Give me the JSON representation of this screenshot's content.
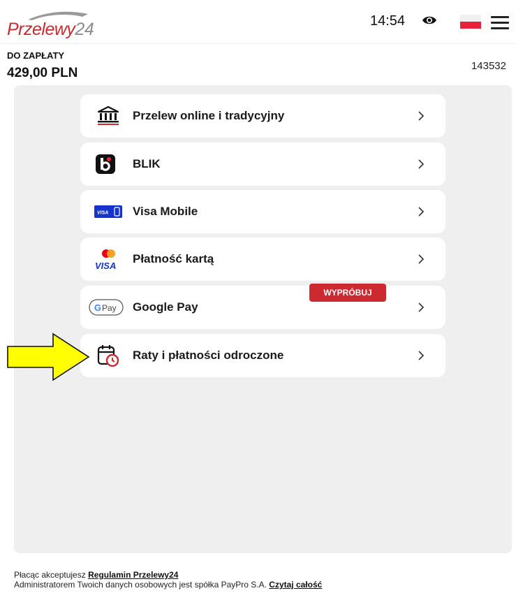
{
  "header": {
    "logo_red": "Przelewy",
    "logo_gray": "24",
    "time": "14:54"
  },
  "payment": {
    "amount_label": "DO ZAPŁATY",
    "amount": "429,00 PLN",
    "order_id": "143532"
  },
  "methods": [
    {
      "label": "Przelew online i tradycyjny",
      "icon": "bank-icon"
    },
    {
      "label": "BLIK",
      "icon": "blik-icon"
    },
    {
      "label": "Visa Mobile",
      "icon": "visa-mobile-icon"
    },
    {
      "label": "Płatność kartą",
      "icon": "card-icon"
    },
    {
      "label": "Google Pay",
      "icon": "google-pay-icon",
      "badge": "WYPRÓBUJ"
    },
    {
      "label": "Raty i płatności odroczone",
      "icon": "calendar-clock-icon"
    }
  ],
  "icon_text": {
    "visa_mobile": "VISA",
    "card_visa": "VISA",
    "gpay": "Pay"
  },
  "footer": {
    "line1_prefix": "Płacąc akceptujesz ",
    "line1_link": "Regulamin Przelewy24",
    "line2_prefix": "Administratorem Twoich danych osobowych jest spółka PayPro S.A. ",
    "line2_link": "Czytaj całość"
  },
  "colors": {
    "brand_red": "#cc2a30",
    "panel_bg": "#efefef",
    "arrow_yellow": "#ffff00"
  }
}
